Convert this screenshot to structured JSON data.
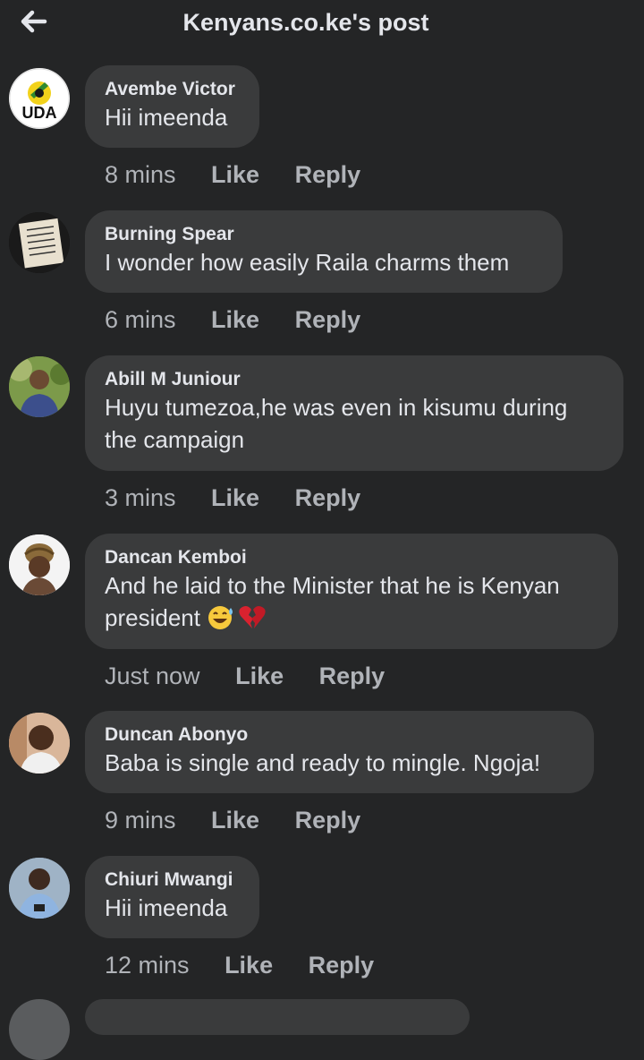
{
  "header": {
    "title": "Kenyans.co.ke's post"
  },
  "comments": [
    {
      "author": "Avembe Victor",
      "text": "Hii imeenda",
      "time": "8 mins",
      "like": "Like",
      "reply": "Reply"
    },
    {
      "author": "Burning Spear",
      "text": "I wonder how easily Raila charms them",
      "time": "6 mins",
      "like": "Like",
      "reply": "Reply"
    },
    {
      "author": "Abill M Juniour",
      "text": "Huyu tumezoa,he was even in kisumu during the campaign",
      "time": "3 mins",
      "like": "Like",
      "reply": "Reply"
    },
    {
      "author": "Dancan Kemboi",
      "text": "And he laid to the Minister that he is Kenyan president",
      "time": "Just now",
      "like": "Like",
      "reply": "Reply"
    },
    {
      "author": "Duncan Abonyo",
      "text": "Baba is single and ready to mingle. Ngoja!",
      "time": "9 mins",
      "like": "Like",
      "reply": "Reply"
    },
    {
      "author": "Chiuri Mwangi",
      "text": "Hii imeenda",
      "time": "12 mins",
      "like": "Like",
      "reply": "Reply"
    }
  ],
  "avatars": {
    "uda_logo_text": "UDA"
  },
  "colors": {
    "background": "#242526",
    "bubble": "#3a3b3c",
    "text": "#e4e6eb",
    "meta": "#b0b3b8"
  }
}
